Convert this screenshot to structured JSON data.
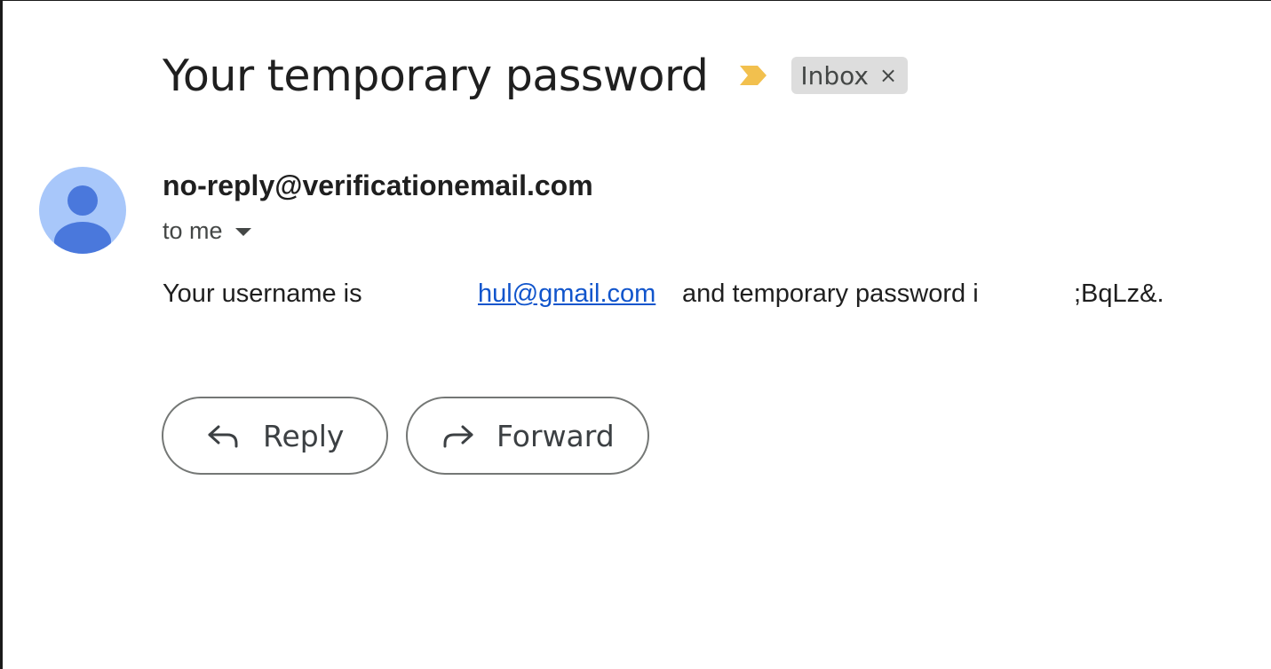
{
  "email": {
    "subject": "Your temporary password",
    "label": {
      "name": "Inbox",
      "close_glyph": "×"
    },
    "importance_marker_color": "#f2c04e",
    "sender": {
      "address": "no-reply@verificationemail.com",
      "recipient_text": "to me",
      "avatar_bg_color": "#a8c7fa",
      "avatar_fg_color": "#4a78dc"
    },
    "body": {
      "segment_1": "Your username is",
      "link_text": "hul@gmail.com",
      "segment_2": "and temporary password i",
      "segment_3": ";BqLz&."
    },
    "actions": {
      "reply_label": "Reply",
      "forward_label": "Forward"
    },
    "link_color": "#1155cc"
  }
}
